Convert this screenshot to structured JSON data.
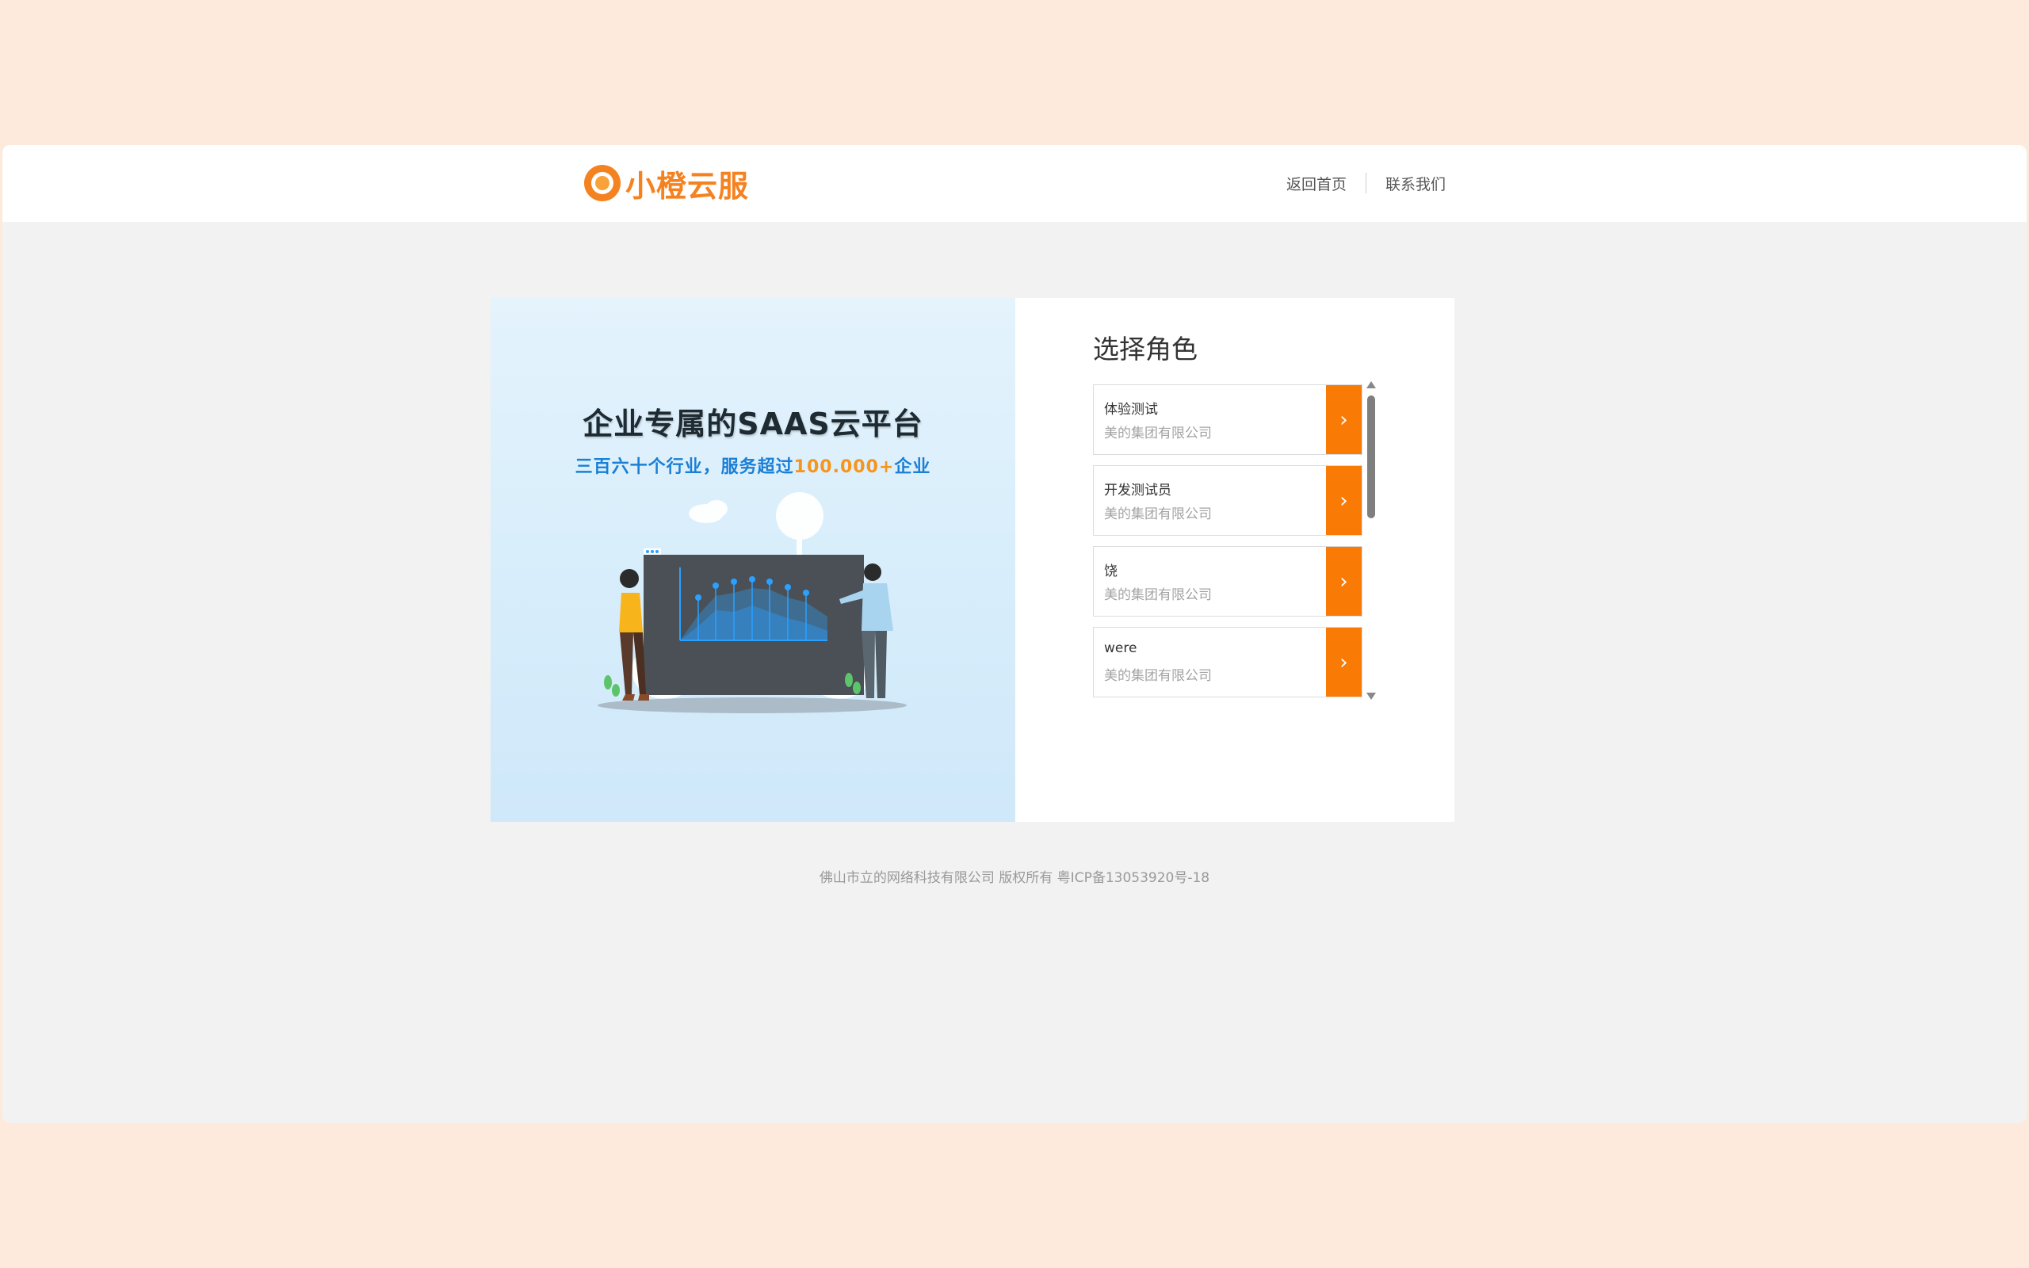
{
  "header": {
    "logo_text": "小橙云服",
    "nav": {
      "home": "返回首页",
      "contact": "联系我们"
    }
  },
  "hero": {
    "title": "企业专属的SAAS云平台",
    "subtitle_prefix": "三百六十个行业，服务超过",
    "subtitle_highlight": "100.000+",
    "subtitle_suffix": "企业"
  },
  "role_panel": {
    "title": "选择角色",
    "roles": [
      {
        "name": "体验测试",
        "company": "美的集团有限公司"
      },
      {
        "name": "开发测试员",
        "company": "美的集团有限公司"
      },
      {
        "name": "饶",
        "company": "美的集团有限公司"
      },
      {
        "name": "were",
        "company": "美的集团有限公司"
      }
    ],
    "arrow_icon": "›"
  },
  "footer": {
    "text": "佛山市立的网络科技有限公司 版权所有  粤ICP备13053920号-18"
  },
  "colors": {
    "accent": "#f97b05",
    "page_bg": "#fdeadc",
    "content_bg": "#f2f2f2"
  }
}
